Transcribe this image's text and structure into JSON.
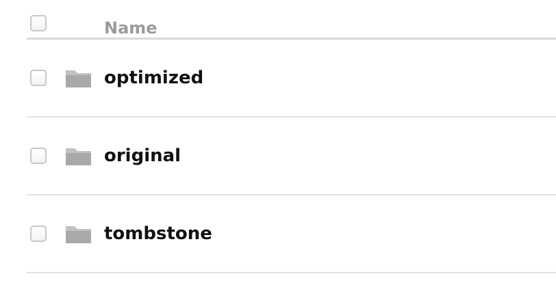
{
  "table": {
    "header": {
      "name_label": "Name"
    },
    "rows": [
      {
        "name": "optimized",
        "icon": "folder-icon"
      },
      {
        "name": "original",
        "icon": "folder-icon"
      },
      {
        "name": "tombstone",
        "icon": "folder-icon"
      }
    ]
  },
  "colors": {
    "header_text": "#9b9b9b",
    "row_text": "#111111",
    "folder": "#a9a9a9",
    "checkbox_border": "#c8c8c8",
    "divider": "#e1e1e1"
  }
}
